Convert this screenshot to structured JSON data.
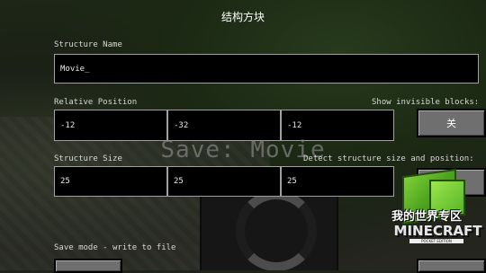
{
  "title": "结构方块",
  "structure_name": {
    "label": "Structure Name",
    "value": "Movie_"
  },
  "relative_position": {
    "label": "Relative Position",
    "x": "-12",
    "y": "-32",
    "z": "-12"
  },
  "show_invisible": {
    "label": "Show invisible blocks:",
    "button": "关"
  },
  "structure_size": {
    "label": "Structure Size",
    "x": "25",
    "y": "25",
    "z": "25"
  },
  "detect": {
    "label": "Detect structure size and position:"
  },
  "save_overlay": "Save: Movie",
  "mode": {
    "label": "Save mode - write to file"
  },
  "logo": {
    "cn_text": "我的世界专区",
    "brand": "MINECRAFT",
    "edition": "POCKET EDITION"
  }
}
